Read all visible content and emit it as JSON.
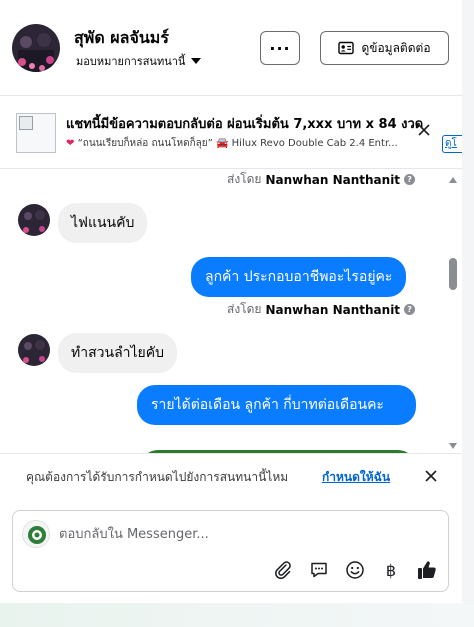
{
  "header": {
    "contact_name": "สุพัด ผลจันมร์",
    "assign_label": "มอบหมายการสนทนานี้",
    "more_label": "···",
    "contact_button": "ดูข้อมูลติดต่อ",
    "more_icon": "more-icon",
    "contact_icon": "contact-card-icon"
  },
  "ad": {
    "title": "แชทนี้มีข้อความตอบกลับต่อ ผ่อนเริ่มต้น 7,xxx บาท x 84 งวด",
    "subtitle": "“ถนนเรียบก็หล่อ ถนนโหดก็ลุย” 🚘 Hilux Revo Double Cab 2.4 Entr...",
    "link_label": "ดูโ",
    "heart_icon": "heart-icon"
  },
  "messages": {
    "sent_by_prefix": "ส่งโดย",
    "sent_by_name": "Nanwhan Nanthanit",
    "info_glyph": "?",
    "items": [
      {
        "direction": "in",
        "text": "ไฟแนนคับ"
      },
      {
        "direction": "out",
        "text": "ลูกค้า ประกอบอาชีพอะไรอยู่คะ"
      },
      {
        "direction": "in",
        "text": "ทำสวนลำไยคับ"
      },
      {
        "direction": "out",
        "text": "รายได้ต่อเดือน  ลูกค้า  กี่บาทต่อเดือนคะ"
      }
    ]
  },
  "notice": {
    "text": "คุณต้องการได้รับการกำหนดไปยังการสนทนานี้ไหม",
    "link": "กำหนดให้ฉัน"
  },
  "composer": {
    "placeholder": "ตอบกลับใน Messenger...",
    "tools": [
      "paperclip-icon",
      "speech-bubble-icon",
      "emoji-icon",
      "baht-icon",
      "thumbs-up-icon"
    ],
    "baht_glyph": "฿"
  },
  "colors": {
    "brand_blue": "#0a7cff",
    "link_blue": "#0064d1",
    "incoming_bubble": "#f0f0f0",
    "green_bubble": "#2d7a2d"
  }
}
